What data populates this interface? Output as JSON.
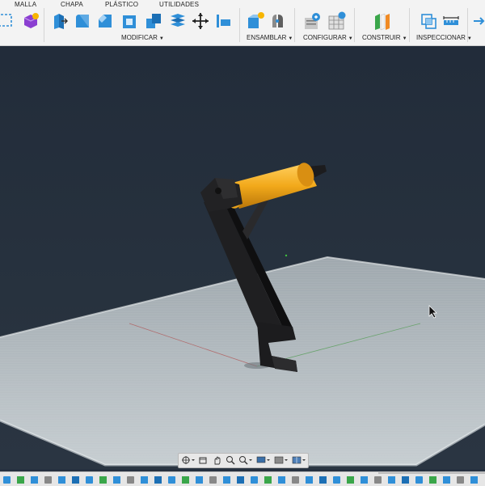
{
  "tabs": [
    "MALLA",
    "CHAPA",
    "PLÁSTICO",
    "UTILIDADES"
  ],
  "groups": {
    "modificar": "MODIFICAR",
    "ensamblar": "ENSAMBLAR",
    "configurar": "CONFIGURAR",
    "construir": "CONSTRUIR",
    "inspeccionar": "INSPECCIONAR"
  },
  "colors": {
    "toolbar_bg": "#f3f3f3",
    "viewport_bg": "#263140",
    "model_black": "#1c1c1e",
    "spool_yellow": "#f2a91a",
    "platform": "#b9c1c6",
    "tool_blue": "#2f8fd8"
  },
  "icons": {
    "toolbar": [
      "select-icon",
      "form-icon",
      "press-pull-icon",
      "fillet-icon",
      "chamfer-icon",
      "shell-icon",
      "combine-icon",
      "offset-face-icon",
      "move-icon",
      "align-icon",
      "new-component-icon",
      "joint-icon",
      "parameters-icon",
      "configure-icon",
      "offset-plane-icon",
      "measure-icon",
      "interference-icon"
    ],
    "navbar": [
      "orbit-icon",
      "look-at-icon",
      "pan-icon",
      "zoom-icon",
      "fit-icon",
      "display-settings-icon",
      "grid-icon",
      "viewports-icon"
    ],
    "cursor": "mouse-pointer-icon"
  }
}
